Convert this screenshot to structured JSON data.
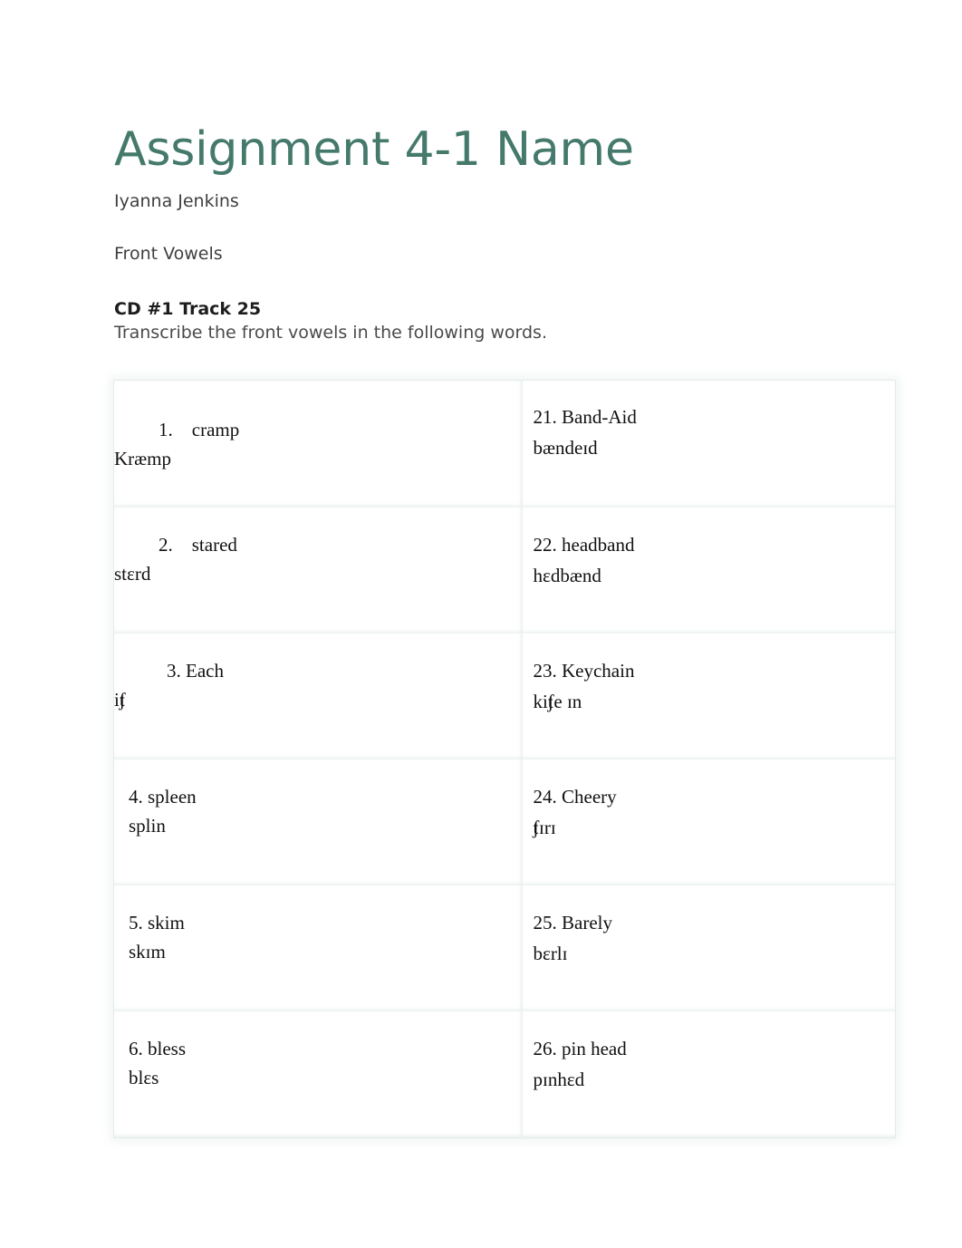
{
  "document": {
    "title": "Assignment 4-1 Name",
    "author": "Iyanna Jenkins",
    "section": "Front Vowels",
    "track": "CD #1 Track 25",
    "instruction": "Transcribe the front vowels in the following words."
  },
  "colors": {
    "title": "#44796b",
    "body_text": "#3f3f3f",
    "cell_text": "#111111",
    "table_border": "#eef3f1",
    "page_background": "#ffffff"
  },
  "table": {
    "rows": [
      {
        "left": {
          "word": "1. cramp",
          "ipa": "Kræmp"
        },
        "right": {
          "word": "21. Band-Aid",
          "ipa": "bændeɪd"
        }
      },
      {
        "left": {
          "word": "2. stared",
          "ipa": "stɛrd"
        },
        "right": {
          "word": "22. headband",
          "ipa": "hɛdbænd"
        }
      },
      {
        "left": {
          "word": "3. Each",
          "ipa_pre": "i",
          "ipa_tie": "tʃ",
          "ipa_post": ""
        },
        "right": {
          "word": "23. Keychain",
          "ipa_pre": "ki",
          "ipa_tie": "tʃ",
          "ipa_post": "e ɪn"
        }
      },
      {
        "left": {
          "word": "4. spleen",
          "ipa": "splin"
        },
        "right": {
          "word": "24. Cheery",
          "ipa_pre": "",
          "ipa_tie": "tʃ",
          "ipa_post": "ɪrɪ"
        }
      },
      {
        "left": {
          "word": "5. skim",
          "ipa": "skɪm"
        },
        "right": {
          "word": "25. Barely",
          "ipa": "bɛrlɪ"
        }
      },
      {
        "left": {
          "word": "6. bless",
          "ipa": "blɛs"
        },
        "right": {
          "word": "26. pin head",
          "ipa": "pɪnhɛd"
        }
      }
    ]
  }
}
